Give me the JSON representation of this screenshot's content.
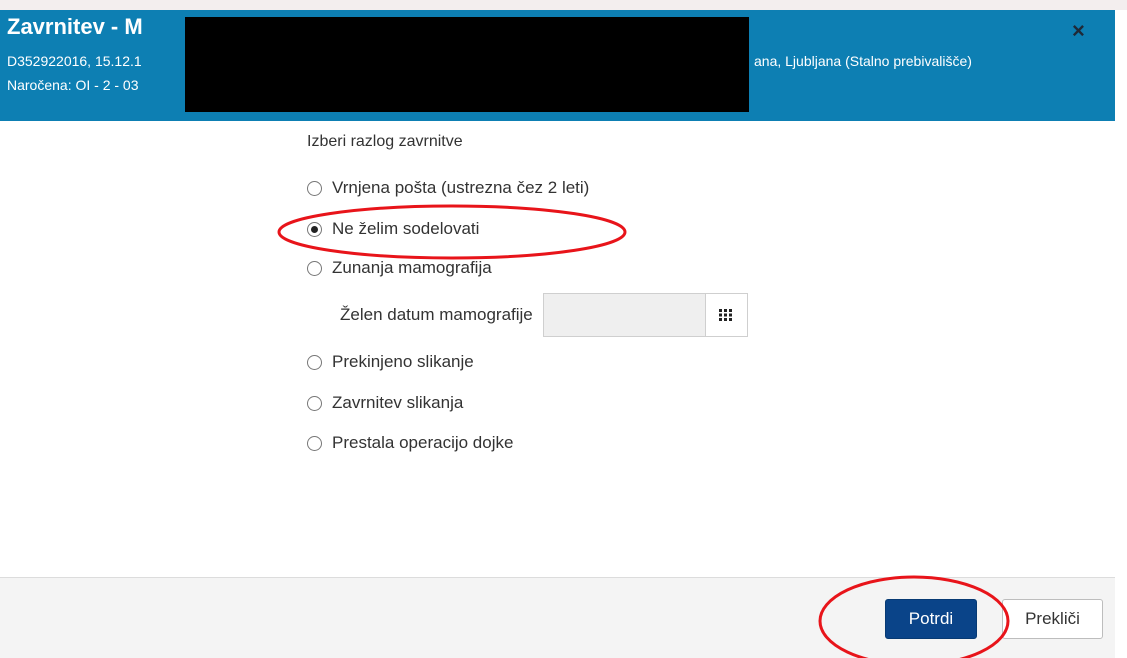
{
  "dialog": {
    "title": "Zavrnitev - M",
    "patient_line_left": "D352922016, 15.12.1",
    "patient_line_right": "ana, Ljubljana (Stalno prebivališče)",
    "order_line": "Naročena: OI - 2 - 03",
    "close_symbol": "×"
  },
  "form": {
    "section_label": "Izberi razlog zavrnitve",
    "options": [
      {
        "label": "Vrnjena pošta (ustrezna čez 2 leti)",
        "checked": false
      },
      {
        "label": "Ne želim sodelovati",
        "checked": true
      },
      {
        "label": "Zunanja mamografija",
        "checked": false
      },
      {
        "label": "Prekinjeno slikanje",
        "checked": false
      },
      {
        "label": "Zavrnitev slikanja",
        "checked": false
      },
      {
        "label": "Prestala operacijo dojke",
        "checked": false
      }
    ],
    "date_label": "Želen datum mamografije",
    "date_value": ""
  },
  "footer": {
    "confirm_label": "Potrdi",
    "cancel_label": "Prekliči"
  },
  "colors": {
    "header": "#0d7fb3",
    "primary_button": "#0a4489",
    "annotation": "#e8141a"
  },
  "icons": {
    "calendar": "calendar-grid-icon",
    "close": "close-icon"
  }
}
